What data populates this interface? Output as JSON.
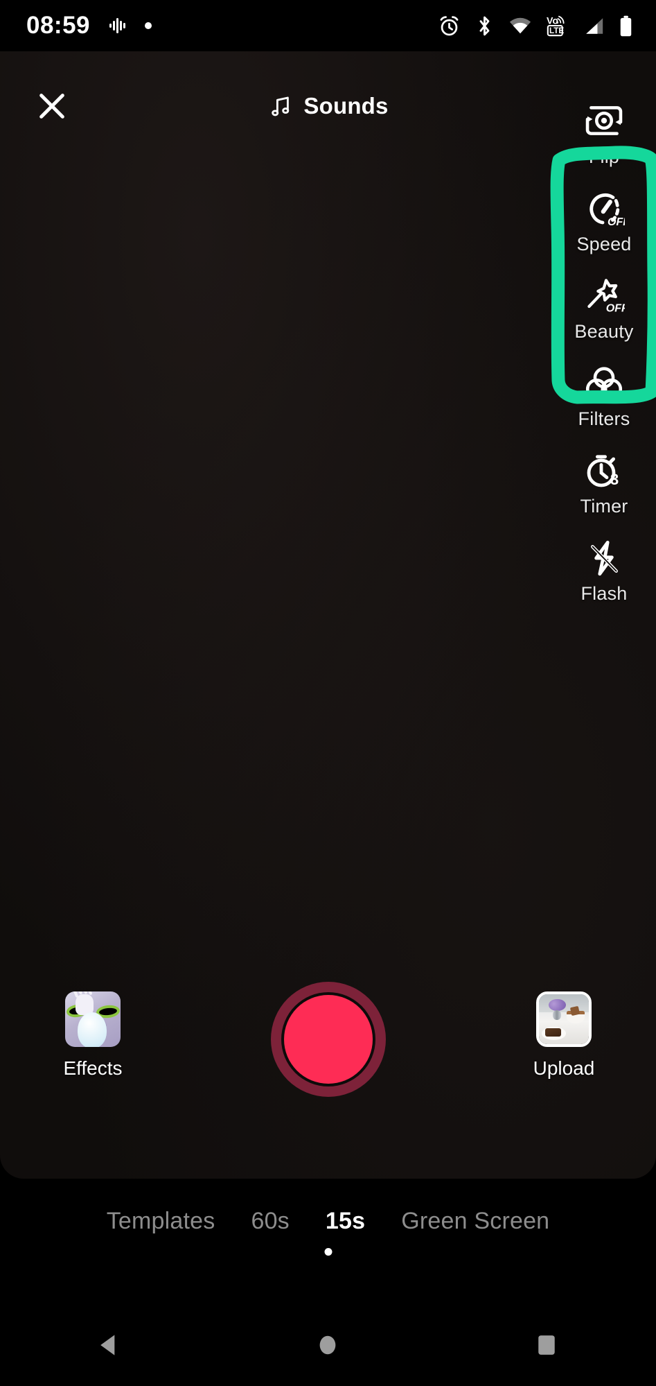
{
  "status_bar": {
    "time": "08:59",
    "left_icons": [
      "google-assistant-icon",
      "dot-indicator-icon"
    ],
    "right_icons": [
      "alarm-icon",
      "bluetooth-icon",
      "wifi-icon",
      "volte-icon",
      "signal-icon",
      "battery-icon"
    ],
    "volte_text_top": "Vo",
    "volte_text_bottom": "LTE"
  },
  "header": {
    "close_label": "close-icon",
    "sounds_label": "Sounds"
  },
  "tool_rail": {
    "items": [
      {
        "icon": "camera-flip-icon",
        "label": "Flip",
        "badge": ""
      },
      {
        "icon": "speed-gauge-icon",
        "label": "Speed",
        "badge": "OFF"
      },
      {
        "icon": "beauty-wand-icon",
        "label": "Beauty",
        "badge": "OFF"
      },
      {
        "icon": "filters-circles-icon",
        "label": "Filters",
        "badge": ""
      },
      {
        "icon": "timer-stopwatch-icon",
        "label": "Timer",
        "badge": "3"
      },
      {
        "icon": "flash-off-icon",
        "label": "Flash",
        "badge": ""
      }
    ],
    "highlight": {
      "color": "#15D79B",
      "covers": [
        "Speed",
        "Beauty",
        "Filters"
      ]
    }
  },
  "capture_row": {
    "effects_label": "Effects",
    "effects_thumb": "effects-preview-thumbnail",
    "upload_label": "Upload",
    "upload_thumb": "gallery-photo-thumbnail",
    "record_button": "record-button",
    "record_color": "#FE2C55",
    "record_ring_color": "#7D2239"
  },
  "modes": {
    "items": [
      {
        "label": "Templates",
        "active": false
      },
      {
        "label": "60s",
        "active": false
      },
      {
        "label": "15s",
        "active": true
      },
      {
        "label": "Green Screen",
        "active": false
      }
    ]
  },
  "nav_bar": {
    "items": [
      {
        "icon": "back-triangle-icon",
        "name": "nav-back"
      },
      {
        "icon": "home-circle-icon",
        "name": "nav-home"
      },
      {
        "icon": "recents-square-icon",
        "name": "nav-recents"
      }
    ],
    "color": "#9e9e9e"
  }
}
